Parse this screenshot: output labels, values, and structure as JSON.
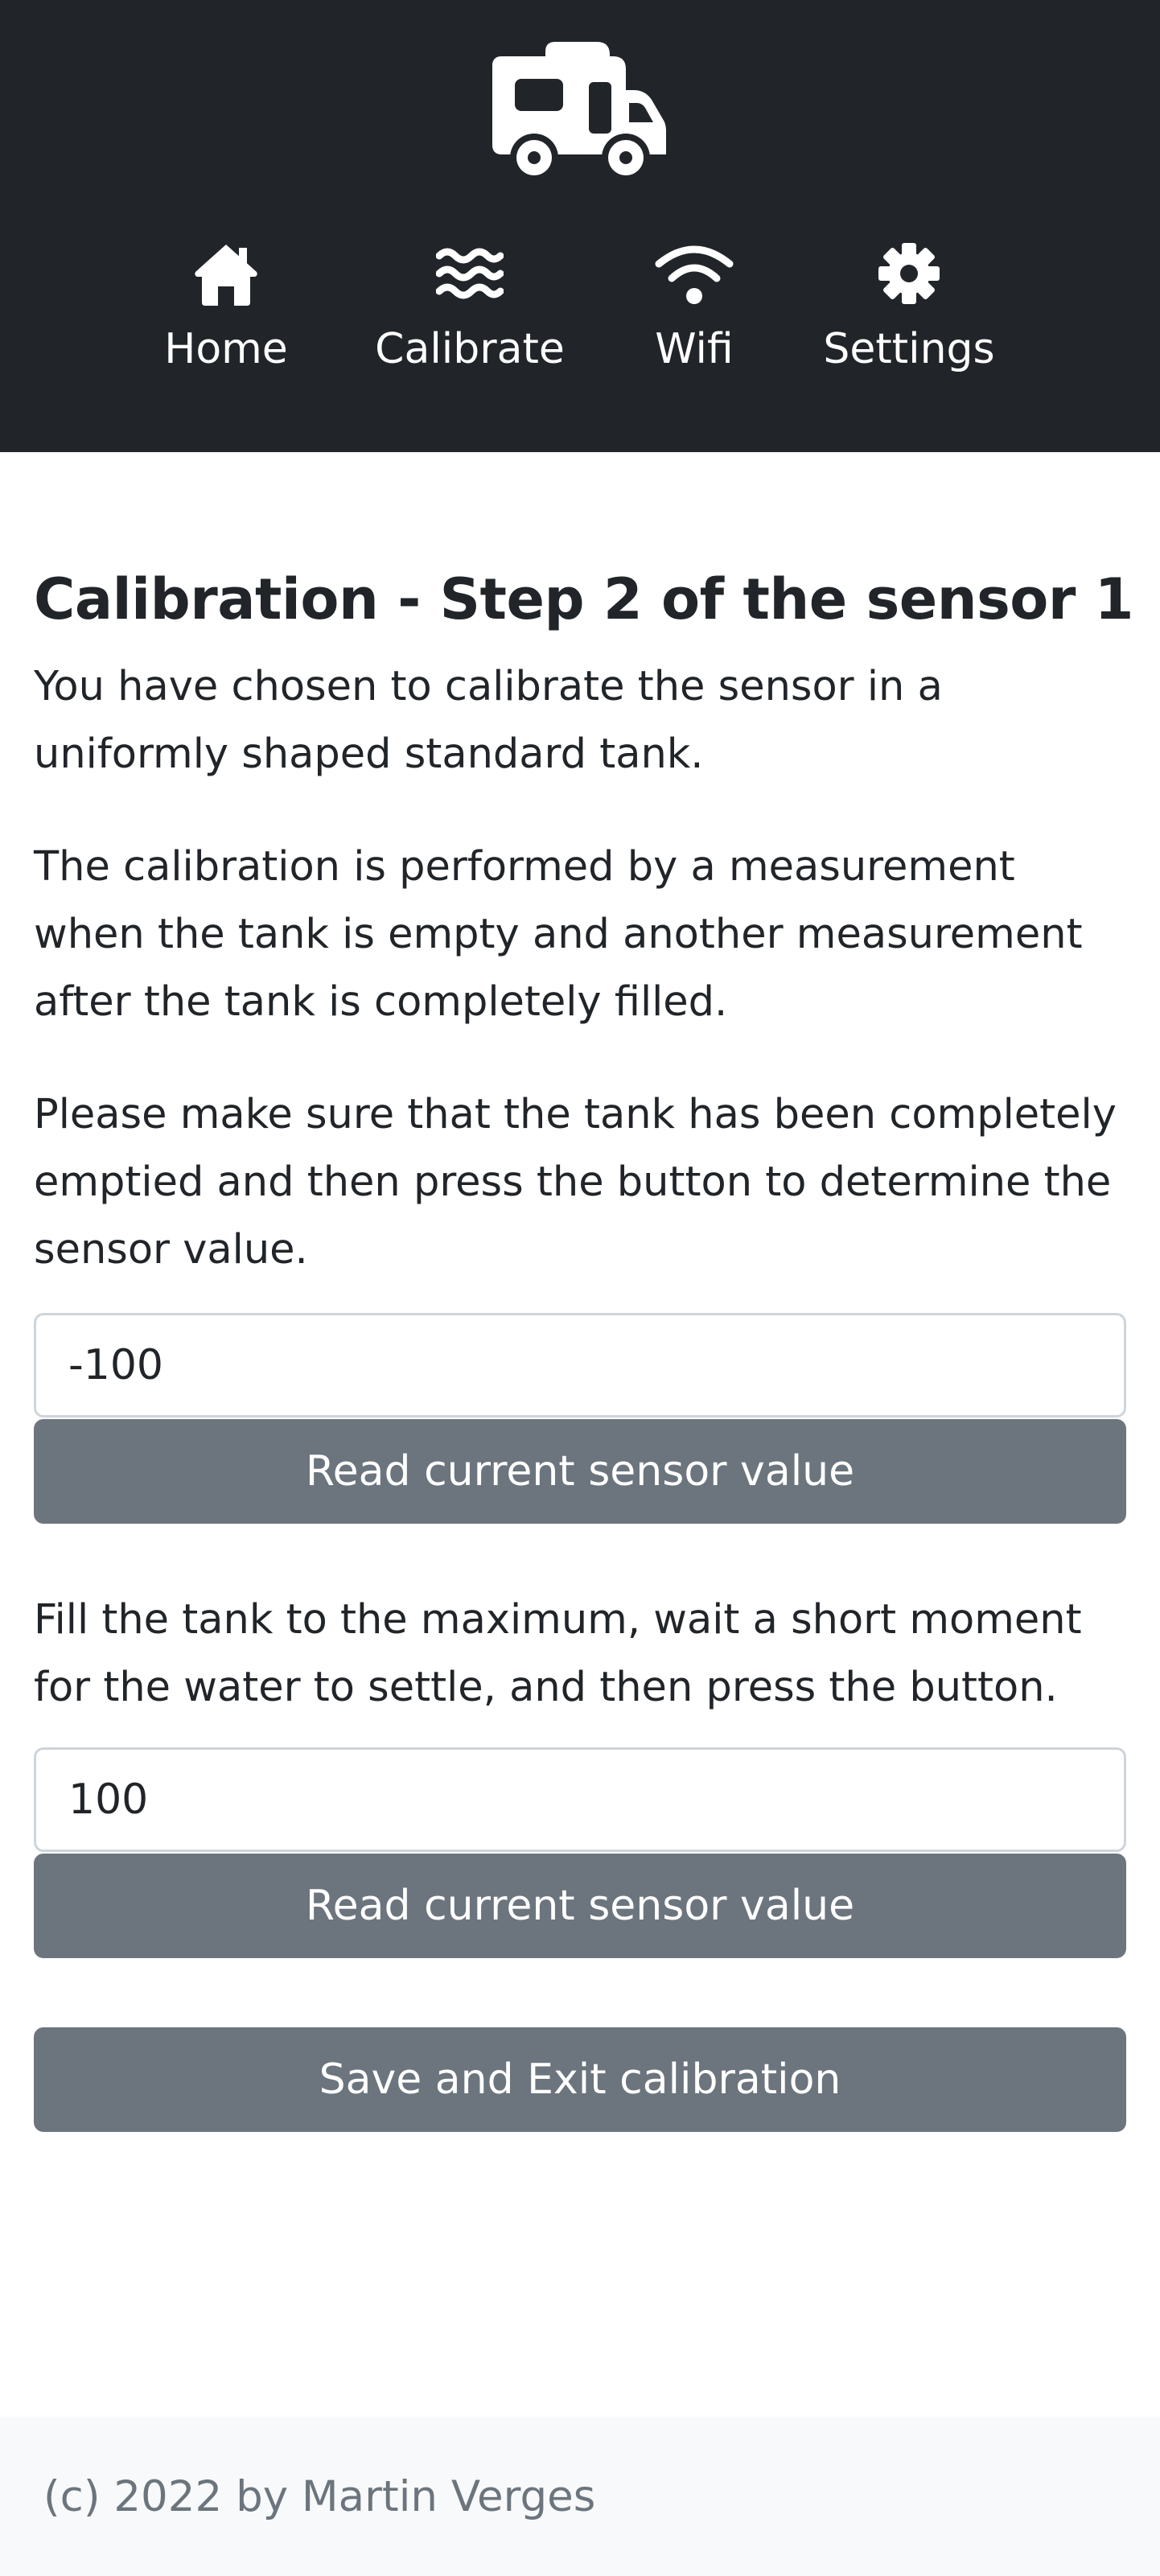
{
  "header": {
    "logo_icon": "caravan-icon",
    "nav": [
      {
        "label": "Home",
        "icon": "home-icon"
      },
      {
        "label": "Calibrate",
        "icon": "water-icon"
      },
      {
        "label": "Wifi",
        "icon": "wifi-icon"
      },
      {
        "label": "Settings",
        "icon": "gear-icon"
      }
    ]
  },
  "main": {
    "title": "Calibration - Step 2 of the sensor 1",
    "intro_text": "You have chosen to calibrate the sensor in a uniformly shaped standard tank.",
    "explanation_text": "The calibration is performed by a measurement when the tank is empty and another measurement after the tank is completely filled.",
    "empty_instruction": "Please make sure that the tank has been completely emptied and then press the button to determine the sensor value.",
    "empty_value": "-100",
    "read_empty_button": "Read current sensor value",
    "full_instruction": "Fill the tank to the maximum, wait a short moment for the water to settle, and then press the button.",
    "full_value": "100",
    "read_full_button": "Read current sensor value",
    "save_button": "Save and Exit calibration"
  },
  "footer": {
    "text": "(c) 2022 by Martin Verges"
  },
  "colors": {
    "header_bg": "#212529",
    "button_bg": "#6c757d",
    "footer_bg": "#f8f9fa",
    "footer_text": "#6c757d"
  }
}
